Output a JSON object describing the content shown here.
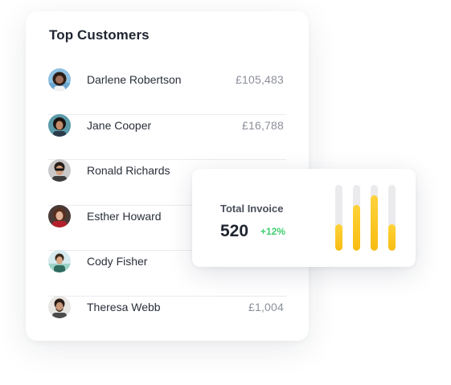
{
  "customers_card": {
    "title": "Top Customers",
    "customers": [
      {
        "name": "Darlene Robertson",
        "amount": "£105,483",
        "avatar": "avatar-photo-curly-hair"
      },
      {
        "name": "Jane Cooper",
        "amount": "£16,788",
        "avatar": "avatar-photo-dark-hair"
      },
      {
        "name": "Ronald Richards",
        "amount": "",
        "avatar": "avatar-photo-sunglasses"
      },
      {
        "name": "Esther Howard",
        "amount": "",
        "avatar": "avatar-photo-red-top"
      },
      {
        "name": "Cody Fisher",
        "amount": "",
        "avatar": "avatar-photo-outdoor"
      },
      {
        "name": "Theresa Webb",
        "amount": "£1,004",
        "avatar": "avatar-photo-beard"
      }
    ]
  },
  "invoice_card": {
    "label": "Total Invoice",
    "value": "520",
    "change": "+12%",
    "bars": [
      0.4,
      0.7,
      0.84,
      0.4
    ],
    "colors": {
      "bar_fill": "#f8bd12",
      "bar_track": "#ebebee",
      "change": "#3ecf6e"
    }
  }
}
